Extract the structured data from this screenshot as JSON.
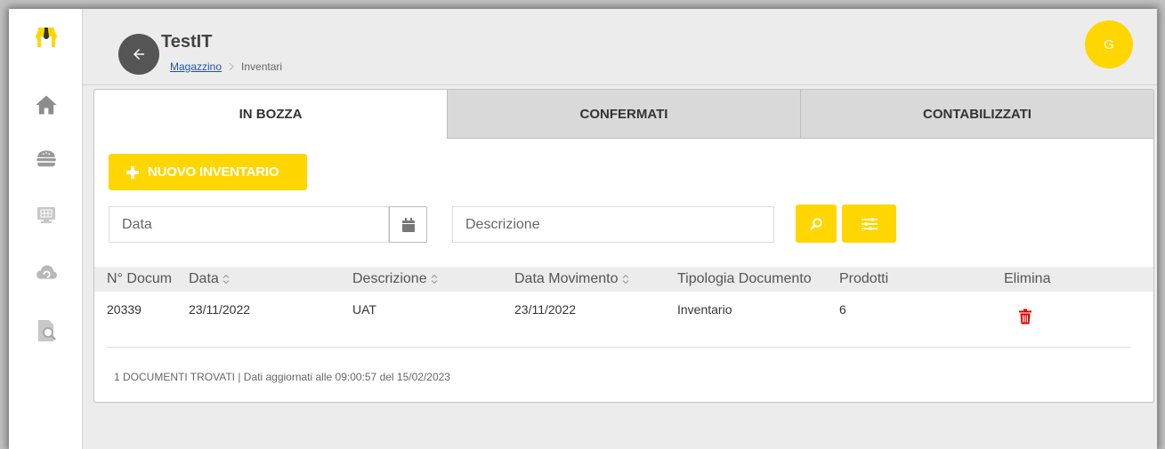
{
  "sidebar": {
    "items": [
      {
        "icon": "shop-icon"
      },
      {
        "icon": "home-icon"
      },
      {
        "icon": "burger-icon"
      },
      {
        "icon": "cash-register-icon"
      },
      {
        "icon": "cloud-icon"
      },
      {
        "icon": "report-search-icon"
      }
    ]
  },
  "header": {
    "title": "TestIT",
    "back_icon": "arrow-left-icon",
    "breadcrumb": [
      {
        "label": "Magazzino",
        "link": true
      },
      {
        "label": "Inventari",
        "link": false
      }
    ],
    "avatar_initial": "G"
  },
  "tabs": [
    {
      "label": "IN BOZZA",
      "active": true
    },
    {
      "label": "CONFERMATI",
      "active": false
    },
    {
      "label": "CONTABILIZZATI",
      "active": false
    }
  ],
  "toolbar": {
    "new_button_icon": "plus-icon",
    "new_button_label": "NUOVO INVENTARIO"
  },
  "filters": {
    "date_placeholder": "Data",
    "date_icon": "calendar-icon",
    "description_placeholder": "Descrizione",
    "search_icon": "search-icon",
    "advanced_filter_icon": "sliders-icon"
  },
  "table": {
    "columns": [
      {
        "label": "N° Docum",
        "sortable": false
      },
      {
        "label": "Data",
        "sortable": true
      },
      {
        "label": "Descrizione",
        "sortable": true
      },
      {
        "label": "Data Movimento",
        "sortable": true
      },
      {
        "label": "Tipologia Documento",
        "sortable": false
      },
      {
        "label": "Prodotti",
        "sortable": false
      },
      {
        "label": "Elimina",
        "sortable": false
      }
    ],
    "rows": [
      {
        "num": "20339",
        "data": "23/11/2022",
        "descrizione": "UAT",
        "data_movimento": "23/11/2022",
        "tipologia": "Inventario",
        "prodotti": "6",
        "delete_icon": "trash-icon"
      }
    ]
  },
  "footer": {
    "status": "1 DOCUMENTI TROVATI | Dati aggiornati alle 09:00:57 del 15/02/2023"
  },
  "colors": {
    "accent": "#ffd600",
    "back_button": "#555555",
    "link": "#2255aa",
    "danger": "#e00000"
  }
}
